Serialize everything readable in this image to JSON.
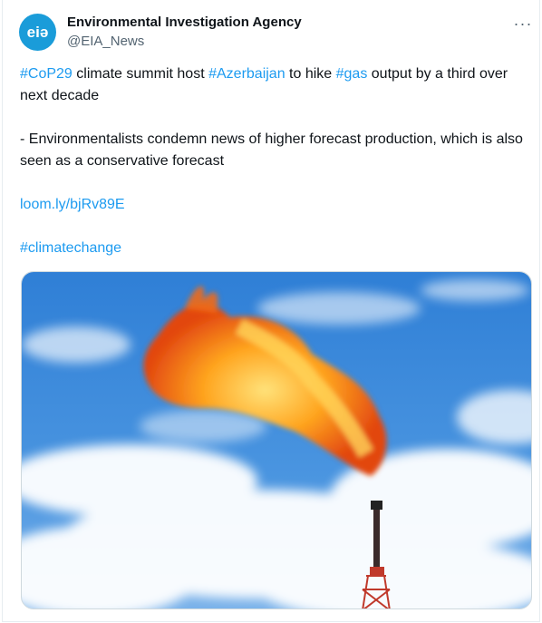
{
  "account": {
    "name": "Environmental Investigation Agency",
    "handle": "@EIA_News",
    "avatar_text": "eiə",
    "avatar_color": "#1a9cd9"
  },
  "more_label": "···",
  "tweet": {
    "line1": {
      "tag1": "#CoP29",
      "text1": " climate summit host ",
      "tag2": "#Azerbaijan",
      "text2": " to hike ",
      "tag3": "#gas",
      "text3": " output by a third over next decade"
    },
    "line2": "- Environmentalists condemn news of higher forecast production, which is also seen as a conservative forecast",
    "link": "loom.ly/bjRv89E",
    "hashtag": "#climatechange"
  },
  "media": {
    "alt": "",
    "subject": "gas flare stack against blue sky"
  },
  "colors": {
    "link": "#1d9bf0",
    "text": "#0f1419",
    "secondary": "#536471"
  }
}
